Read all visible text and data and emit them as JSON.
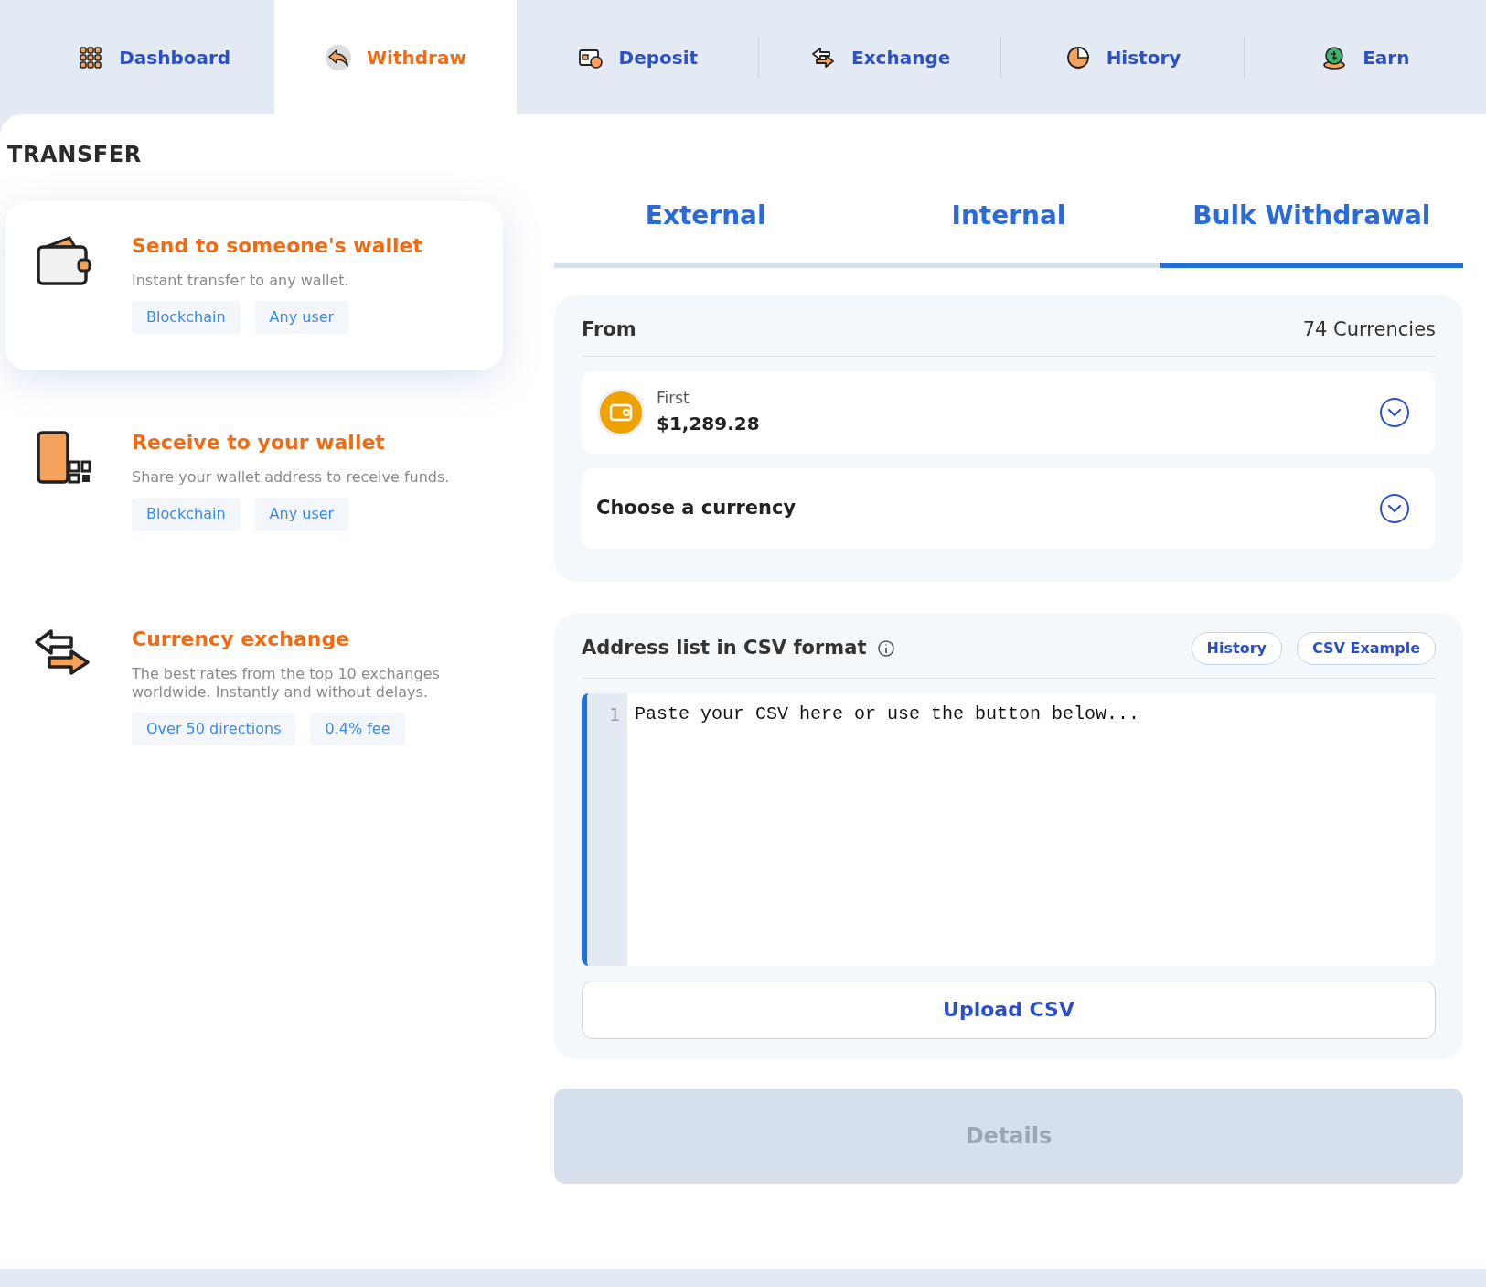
{
  "nav": [
    {
      "label": "Dashboard",
      "kind": "grid",
      "selected": false
    },
    {
      "label": "Withdraw",
      "kind": "reply",
      "selected": true
    },
    {
      "label": "Deposit",
      "kind": "deposit",
      "selected": false
    },
    {
      "label": "Exchange",
      "kind": "exchange",
      "selected": false
    },
    {
      "label": "History",
      "kind": "clock",
      "selected": false
    },
    {
      "label": "Earn",
      "kind": "coin",
      "selected": false
    }
  ],
  "transfer": {
    "title": "TRANSFER",
    "items": [
      {
        "kind": "wallet",
        "title": "Send to someone's wallet",
        "description": "Instant transfer to any wallet.",
        "tags": [
          "Blockchain",
          "Any user"
        ],
        "selected": true
      },
      {
        "kind": "phone",
        "title": "Receive to your wallet",
        "description": "Share your wallet address to receive funds.",
        "tags": [
          "Blockchain",
          "Any user"
        ],
        "selected": false
      },
      {
        "kind": "exchange",
        "title": "Currency exchange",
        "description": "The best rates from the top 10 exchanges worldwide. Instantly and without delays.",
        "tags": [
          "Over 50 directions",
          "0.4% fee"
        ],
        "selected": false
      }
    ]
  },
  "tabs": [
    {
      "label": "External",
      "selected": false
    },
    {
      "label": "Internal",
      "selected": false
    },
    {
      "label": "Bulk Withdrawal",
      "selected": true
    }
  ],
  "from": {
    "label": "From",
    "count": "74 Currencies",
    "wallet": {
      "name": "First",
      "balance": "$1,289.28"
    },
    "currency_placeholder": "Choose a currency"
  },
  "csv": {
    "label": "Address list in CSV format",
    "buttons": [
      "History",
      "CSV Example"
    ],
    "line_number": "1",
    "placeholder": "Paste your CSV here or use the button below...",
    "upload": "Upload CSV"
  },
  "details": {
    "label": "Details",
    "disabled": true
  }
}
